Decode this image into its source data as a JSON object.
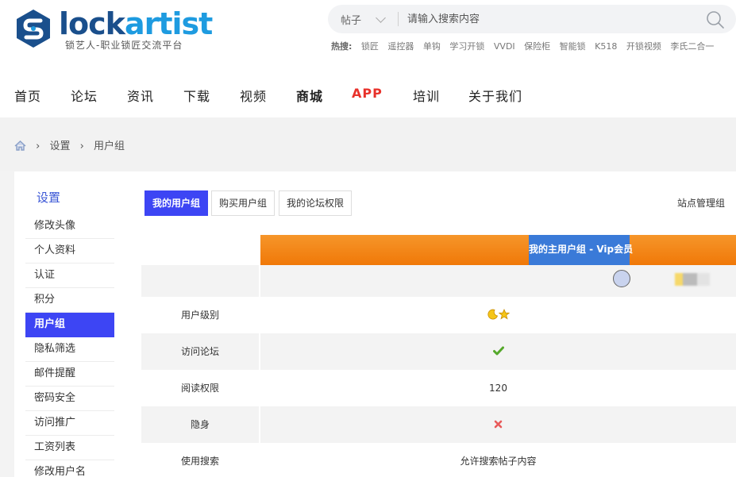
{
  "brand": {
    "name_part1": "lock",
    "name_part2": "artist",
    "tagline": "锁艺人-职业锁匠交流平台",
    "colors": {
      "primary": "#1a4f8c",
      "accent": "#1e9be0"
    }
  },
  "search": {
    "type": "帖子",
    "placeholder": "请输入搜索内容"
  },
  "hot": {
    "label": "热搜:",
    "items": [
      "锁匠",
      "遥控器",
      "单钩",
      "学习开锁",
      "VVDI",
      "保险柜",
      "智能锁",
      "K518",
      "开锁视频",
      "李氏二合一"
    ]
  },
  "nav": {
    "items": [
      "首页",
      "论坛",
      "资讯",
      "下载",
      "视频",
      "商城",
      "APP",
      "培训",
      "关于我们"
    ]
  },
  "breadcrumb": {
    "items": [
      "设置",
      "用户组"
    ]
  },
  "sidebar": {
    "title": "设置",
    "items": [
      "修改头像",
      "个人资料",
      "认证",
      "积分",
      "用户组",
      "隐私筛选",
      "邮件提醒",
      "密码安全",
      "访问推广",
      "工资列表",
      "修改用户名"
    ],
    "active_index": 4,
    "colors": {
      "active_bg": "#3d45f4",
      "title": "#3b57d6"
    }
  },
  "tabs": {
    "items": [
      "我的用户组",
      "购买用户组",
      "我的论坛权限"
    ],
    "active_index": 0,
    "right_label": "站点管理组"
  },
  "group_table": {
    "header_label": "我的主用户组 - Vip会员",
    "colors": {
      "header_bar": "#f07808",
      "header_cell": "#3a7ad8"
    },
    "rows": [
      {
        "label": "用户级别",
        "value": ""
      },
      {
        "label": "访问论坛",
        "value": ""
      },
      {
        "label": "阅读权限",
        "value": "120"
      },
      {
        "label": "隐身",
        "value": ""
      },
      {
        "label": "使用搜索",
        "value": "允许搜索帖子内容"
      }
    ],
    "icons": {
      "level": [
        "moon-icon",
        "star-icon"
      ],
      "forum_access": "check-icon",
      "invisible": "cross-icon"
    }
  }
}
